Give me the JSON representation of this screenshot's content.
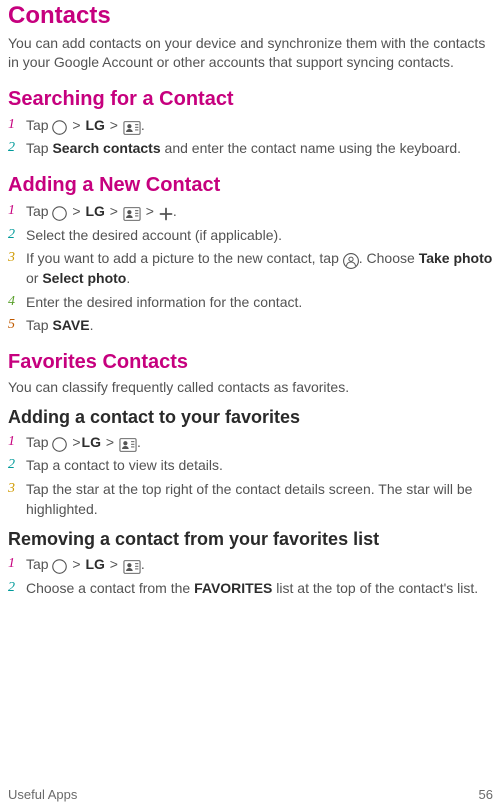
{
  "title": "Contacts",
  "intro": "You can add contacts on your device and synchronize them with the contacts in your Google Account or other accounts that support syncing contacts.",
  "footer": {
    "section": "Useful Apps",
    "page_no": "56"
  },
  "search": {
    "heading": "Searching for a Contact",
    "step1": {
      "tap": "Tap ",
      "lg": "LG",
      "gt": " > ",
      "period": "."
    },
    "step2": {
      "tap": "Tap ",
      "label": "Search contacts",
      "rest": " and enter the contact name using the keyboard."
    }
  },
  "add": {
    "heading": "Adding a New Contact",
    "step1": {
      "tap": "Tap ",
      "lg": "LG",
      "gt": " > ",
      "period": "."
    },
    "step2": "Select the desired account (if applicable).",
    "step3": {
      "pre": "If you want to add a picture to the new contact, tap ",
      "post": ". Choose ",
      "opt1": "Take photo",
      "or": " or ",
      "opt2": "Select photo",
      "period": "."
    },
    "step4": "Enter the desired information for the contact.",
    "step5": {
      "tap": "Tap ",
      "label": "SAVE",
      "period": "."
    }
  },
  "fav": {
    "heading": "Favorites Contacts",
    "intro": "You can classify frequently called contacts as favorites.",
    "add_heading": "Adding a contact to your favorites",
    "add_step1": {
      "tap": "Tap ",
      "lg": "LG",
      "gt": " > ",
      "gt_tight": " >",
      "period": "."
    },
    "add_step2": "Tap a contact to view its details.",
    "add_step3": "Tap the star at the top right of the contact details screen. The star will be highlighted.",
    "rem_heading": "Removing a contact from your favorites list",
    "rem_step1": {
      "tap": "Tap ",
      "lg": "LG",
      "gt": " > ",
      "period": "."
    },
    "rem_step2": {
      "pre": "Choose a contact from the ",
      "label": "FAVORITES",
      "post": " list at the top of the contact's list."
    }
  },
  "icons": {
    "home": "home-circle-icon",
    "contacts": "contacts-icon",
    "plus": "plus-icon",
    "photo": "photo-placeholder-icon"
  }
}
